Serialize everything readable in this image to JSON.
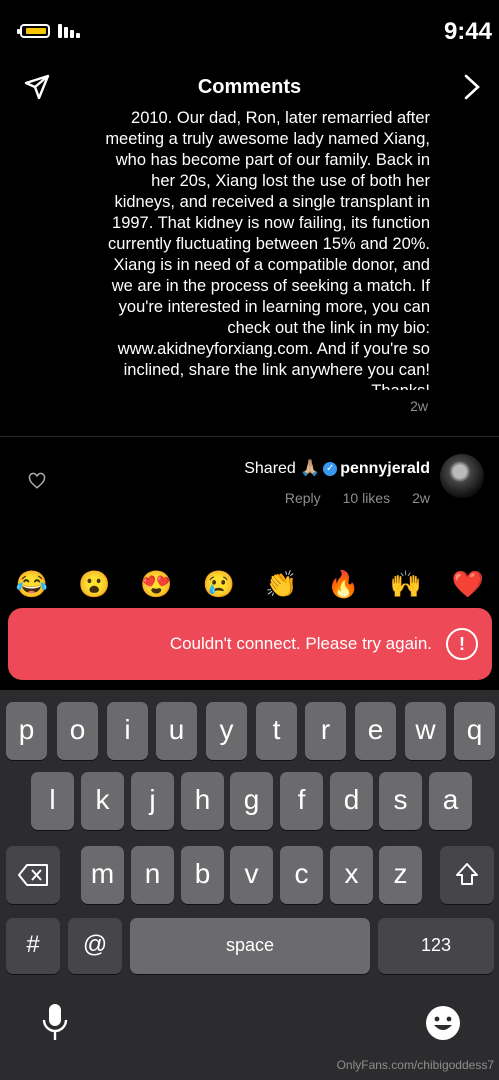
{
  "status_bar": {
    "time": "9:44"
  },
  "header": {
    "title": "Comments"
  },
  "comment": {
    "text": "2010.  Our dad, Ron, later remarried after meeting a truly awesome lady named Xiang, who has become part of our family.  Back in her 20s, Xiang lost the use of both her kidneys, and received a single transplant in 1997.  That kidney is now failing, its function currently fluctuating between 15% and 20%. Xiang is in need of a compatible donor, and we are in the process of seeking a match.  If you're interested in learning more, you can check out the link in my bio: www.akidneyforxiang.com. And if you're so inclined, share the link anywhere you can!  Thanks!",
    "time": "2w"
  },
  "reply": {
    "username": "pennyjerald",
    "text": "Shared 🙏🏼",
    "time": "2w",
    "likes": "10 likes",
    "reply_label": "Reply"
  },
  "emojis": [
    "😂",
    "😮",
    "😍",
    "😢",
    "👏",
    "🔥",
    "🙌",
    "❤️"
  ],
  "error": {
    "message": "Couldn't connect. Please try again.",
    "icon": "!"
  },
  "keyboard": {
    "row1": [
      "q",
      "w",
      "e",
      "r",
      "t",
      "y",
      "u",
      "i",
      "o",
      "p"
    ],
    "row2": [
      "a",
      "s",
      "d",
      "f",
      "g",
      "h",
      "j",
      "k",
      "l"
    ],
    "row3": [
      "z",
      "x",
      "c",
      "v",
      "b",
      "n",
      "m"
    ],
    "numbers": "123",
    "space": "space",
    "at": "@",
    "hash": "#"
  },
  "watermark": "OnlyFans.com/chibigoddess7"
}
